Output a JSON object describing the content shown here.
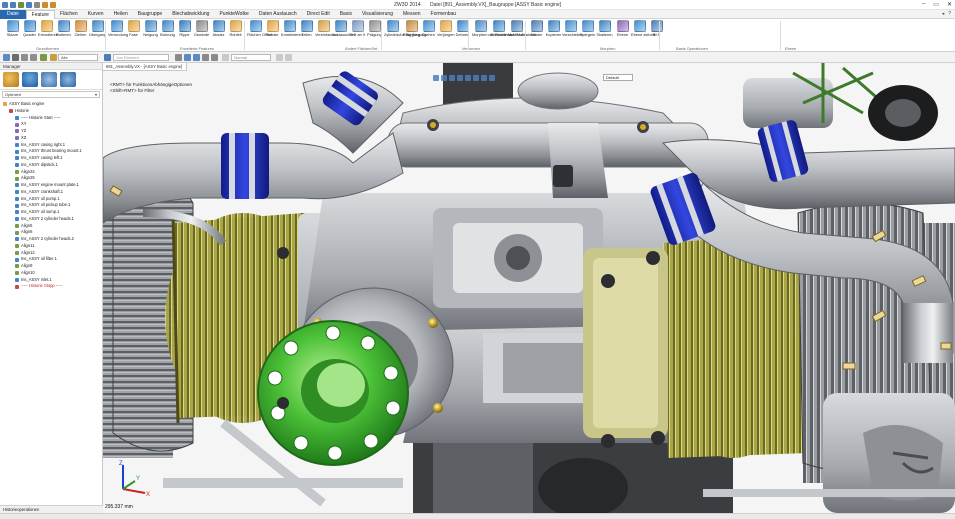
{
  "window": {
    "title": "ZW3D 2014",
    "file": "Datei [891_Assembly.VX]_Baugruppe [ASSY Basic engine]",
    "controls": [
      "–",
      "▭",
      "✕"
    ]
  },
  "menu": {
    "tabs": [
      "Datei",
      "Feature",
      "Flächen",
      "Kurven",
      "Heilen",
      "Baugruppe",
      "Blechabwicklung",
      "PunkteWolke",
      "Daten Austausch",
      "Direct Edit",
      "Basis",
      "Visualisierung",
      "Messen",
      "Formenbau"
    ],
    "active": "Feature",
    "right": [
      "◂",
      "?"
    ]
  },
  "ribbon": {
    "tools": [
      {
        "label": "Skizze",
        "icon": "sketch-icon",
        "color": "#3f8ed0"
      },
      {
        "label": "Quader",
        "icon": "box-icon",
        "color": "#3b86cc"
      },
      {
        "label": "Extrudieren",
        "icon": "extrude-icon",
        "color": "#e3a43a"
      },
      {
        "label": "Rotieren",
        "icon": "revolve-icon",
        "color": "#3f86c9"
      },
      {
        "label": "Ziehen",
        "icon": "sweep-icon",
        "color": "#d3903a"
      },
      {
        "label": "Übergang",
        "icon": "loft-icon",
        "color": "#3d8acb"
      },
      {
        "label": "Verrundung",
        "icon": "fillet-icon",
        "color": "#3e8bd0"
      },
      {
        "label": "Fase",
        "icon": "chamfer-icon",
        "color": "#e0a540"
      },
      {
        "label": "Neigung",
        "icon": "draft-icon",
        "color": "#3f8ac9"
      },
      {
        "label": "Bohrung",
        "icon": "hole-icon",
        "color": "#3f88cd"
      },
      {
        "label": "Rippe",
        "icon": "rib-icon",
        "color": "#357fc3"
      },
      {
        "label": "Gewinde",
        "icon": "thread-icon",
        "color": "#8a8a8a"
      },
      {
        "label": "Absatz",
        "icon": "lip-icon",
        "color": "#3c84c7"
      },
      {
        "label": "Rohteil",
        "icon": "stock-icon",
        "color": "#e2a540"
      },
      {
        "label": "Flächen Offset",
        "icon": "face-offset-icon",
        "color": "#3f8ed0"
      },
      {
        "label": "Schale",
        "icon": "shell-icon",
        "color": "#e2a540"
      },
      {
        "label": "Kombinieren",
        "icon": "combine-icon",
        "color": "#3d8acb"
      },
      {
        "label": "Teilen",
        "icon": "divide-icon",
        "color": "#3a85c8"
      },
      {
        "label": "Vereinfachen",
        "icon": "simplify-icon",
        "color": "#d9a040"
      },
      {
        "label": "Austauschen",
        "icon": "replace-icon",
        "color": "#3d86c8"
      },
      {
        "label": "Teilt an X",
        "icon": "split-icon",
        "color": "#7a9ac2"
      },
      {
        "label": "Prägung",
        "icon": "emboss-icon",
        "color": "#8e8e8e"
      },
      {
        "label": "Zylindrische Biegung",
        "icon": "cyl-bend-icon",
        "color": "#3f8ad0"
      },
      {
        "label": "Ring Biegung",
        "icon": "ring-bend-icon",
        "color": "#c78a3a"
      },
      {
        "label": "Drehen",
        "icon": "twist-icon",
        "color": "#3f8ed0"
      },
      {
        "label": "Verjüngen",
        "icon": "taper-icon",
        "color": "#e2a540"
      },
      {
        "label": "Dehnen",
        "icon": "stretch-icon",
        "color": "#3f86c9"
      },
      {
        "label": "Morphen mit Punkten",
        "icon": "morph-points-icon",
        "color": "#4b8ac7"
      },
      {
        "label": "Abwickeln auf Fläche",
        "icon": "unwrap-icon",
        "color": "#3d86c8"
      },
      {
        "label": "Muster Abwickel.",
        "icon": "pattern-unwrap-icon",
        "color": "#4a7fb8"
      },
      {
        "label": "Muster",
        "icon": "pattern-icon",
        "color": "#4a7fb8"
      },
      {
        "label": "Kopieren",
        "icon": "copy-icon",
        "color": "#3d86c8"
      },
      {
        "label": "Verschieben",
        "icon": "move-icon",
        "color": "#3f8ed0"
      },
      {
        "label": "Spiegeln",
        "icon": "mirror-icon",
        "color": "#3f8ad0"
      },
      {
        "label": "Skalieren",
        "icon": "scale-icon",
        "color": "#3a85c8"
      },
      {
        "label": "Ebene",
        "icon": "plane-icon",
        "color": "#8a6ab8"
      },
      {
        "label": "Ebene ziehen",
        "icon": "drag-plane-icon",
        "color": "#3f8ed0"
      },
      {
        "label": "BKS",
        "icon": "ucs-icon",
        "color": "#4a7fb8"
      }
    ],
    "groups": [
      "Grundformen",
      "Erweiterte Features",
      "Ändert FlächenSet",
      "Verformen",
      "Morphen",
      "Basis Operationen",
      "Ebene"
    ]
  },
  "toolbar": {
    "filter_label": "Alle",
    "element_placeholder": "Von Element",
    "view_mode": "Normal"
  },
  "manager": {
    "title": "Manager",
    "filter": "Optimiert",
    "tree": [
      {
        "label": "ASSY Basic engine",
        "level": 0,
        "red": false,
        "icon_color": "#e2a540"
      },
      {
        "label": "Historie",
        "level": 1,
        "red": false,
        "icon_color": "#c44848"
      },
      {
        "label": "----- Historie Start -----",
        "level": 2,
        "red": false,
        "icon_color": "#3f86c9"
      },
      {
        "label": "XY",
        "level": 2,
        "red": false,
        "icon_color": "#8a6ab8"
      },
      {
        "label": "YZ",
        "level": 2,
        "red": false,
        "icon_color": "#8a6ab8"
      },
      {
        "label": "XZ",
        "level": 2,
        "red": false,
        "icon_color": "#8a6ab8"
      },
      {
        "label": "Ins_ASSY casing right.1",
        "level": 2,
        "red": false,
        "icon_color": "#3f86c9"
      },
      {
        "label": "Ins_ASSY thrust bearing mount.1",
        "level": 2,
        "red": false,
        "icon_color": "#3f86c9"
      },
      {
        "label": "Ins_ASSY casing left.1",
        "level": 2,
        "red": false,
        "icon_color": "#3f86c9"
      },
      {
        "label": "Ins_ASSY dipstick.1",
        "level": 2,
        "red": false,
        "icon_color": "#3f86c9"
      },
      {
        "label": "Align24",
        "level": 2,
        "red": false,
        "icon_color": "#7a9a4a"
      },
      {
        "label": "Align25",
        "level": 2,
        "red": false,
        "icon_color": "#7a9a4a"
      },
      {
        "label": "Ins_ASSY engine mount plate.1",
        "level": 2,
        "red": false,
        "icon_color": "#3f86c9"
      },
      {
        "label": "Ins_ASSY crankshaft.1",
        "level": 2,
        "red": false,
        "icon_color": "#3f86c9"
      },
      {
        "label": "Ins_ASSY oil pump.1",
        "level": 2,
        "red": false,
        "icon_color": "#3f86c9"
      },
      {
        "label": "Ins_ASSY oil pickup tube.1",
        "level": 2,
        "red": false,
        "icon_color": "#3f86c9"
      },
      {
        "label": "Ins_ASSY oil sump.1",
        "level": 2,
        "red": false,
        "icon_color": "#3f86c9"
      },
      {
        "label": "Ins_ASSY 2 cylinder heads.1",
        "level": 2,
        "red": false,
        "icon_color": "#3f86c9"
      },
      {
        "label": "Align5",
        "level": 2,
        "red": false,
        "icon_color": "#7a9a4a"
      },
      {
        "label": "Align6",
        "level": 2,
        "red": false,
        "icon_color": "#7a9a4a"
      },
      {
        "label": "Ins_ASSY 2 cylinder heads.2",
        "level": 2,
        "red": false,
        "icon_color": "#3f86c9"
      },
      {
        "label": "Align11",
        "level": 2,
        "red": false,
        "icon_color": "#7a9a4a"
      },
      {
        "label": "Align12",
        "level": 2,
        "red": false,
        "icon_color": "#7a9a4a"
      },
      {
        "label": "Ins_ASSY oil filter.1",
        "level": 2,
        "red": false,
        "icon_color": "#3f86c9"
      },
      {
        "label": "Align9",
        "level": 2,
        "red": false,
        "icon_color": "#7a9a4a"
      },
      {
        "label": "Align10",
        "level": 2,
        "red": false,
        "icon_color": "#7a9a4a"
      },
      {
        "label": "Ins_ASSY inlet.1",
        "level": 2,
        "red": false,
        "icon_color": "#3f86c9"
      },
      {
        "label": "----- Historie Stopp -----",
        "level": 2,
        "red": true,
        "icon_color": "#c44848"
      }
    ],
    "history_bar": "Historieoperationen"
  },
  "viewport": {
    "tab_label": "891_Assembly.VX - [ASSY Basic engine]",
    "hint1": "<RMT> für FunktionsAbhängigeOptionen",
    "hint2": "<Shift+RMT> für Filter",
    "view_combo": "Default",
    "zoom_readout": "295.337 mm",
    "axes": {
      "x": "X",
      "y": "Y",
      "z": "Z"
    }
  },
  "colors": {
    "accent": "#2a67b1",
    "clamp_blue": "#1f2fc7",
    "cylinder_olive": "#b4b04a",
    "flange_green": "#3fb82e",
    "metal": "#b8bcc1"
  }
}
